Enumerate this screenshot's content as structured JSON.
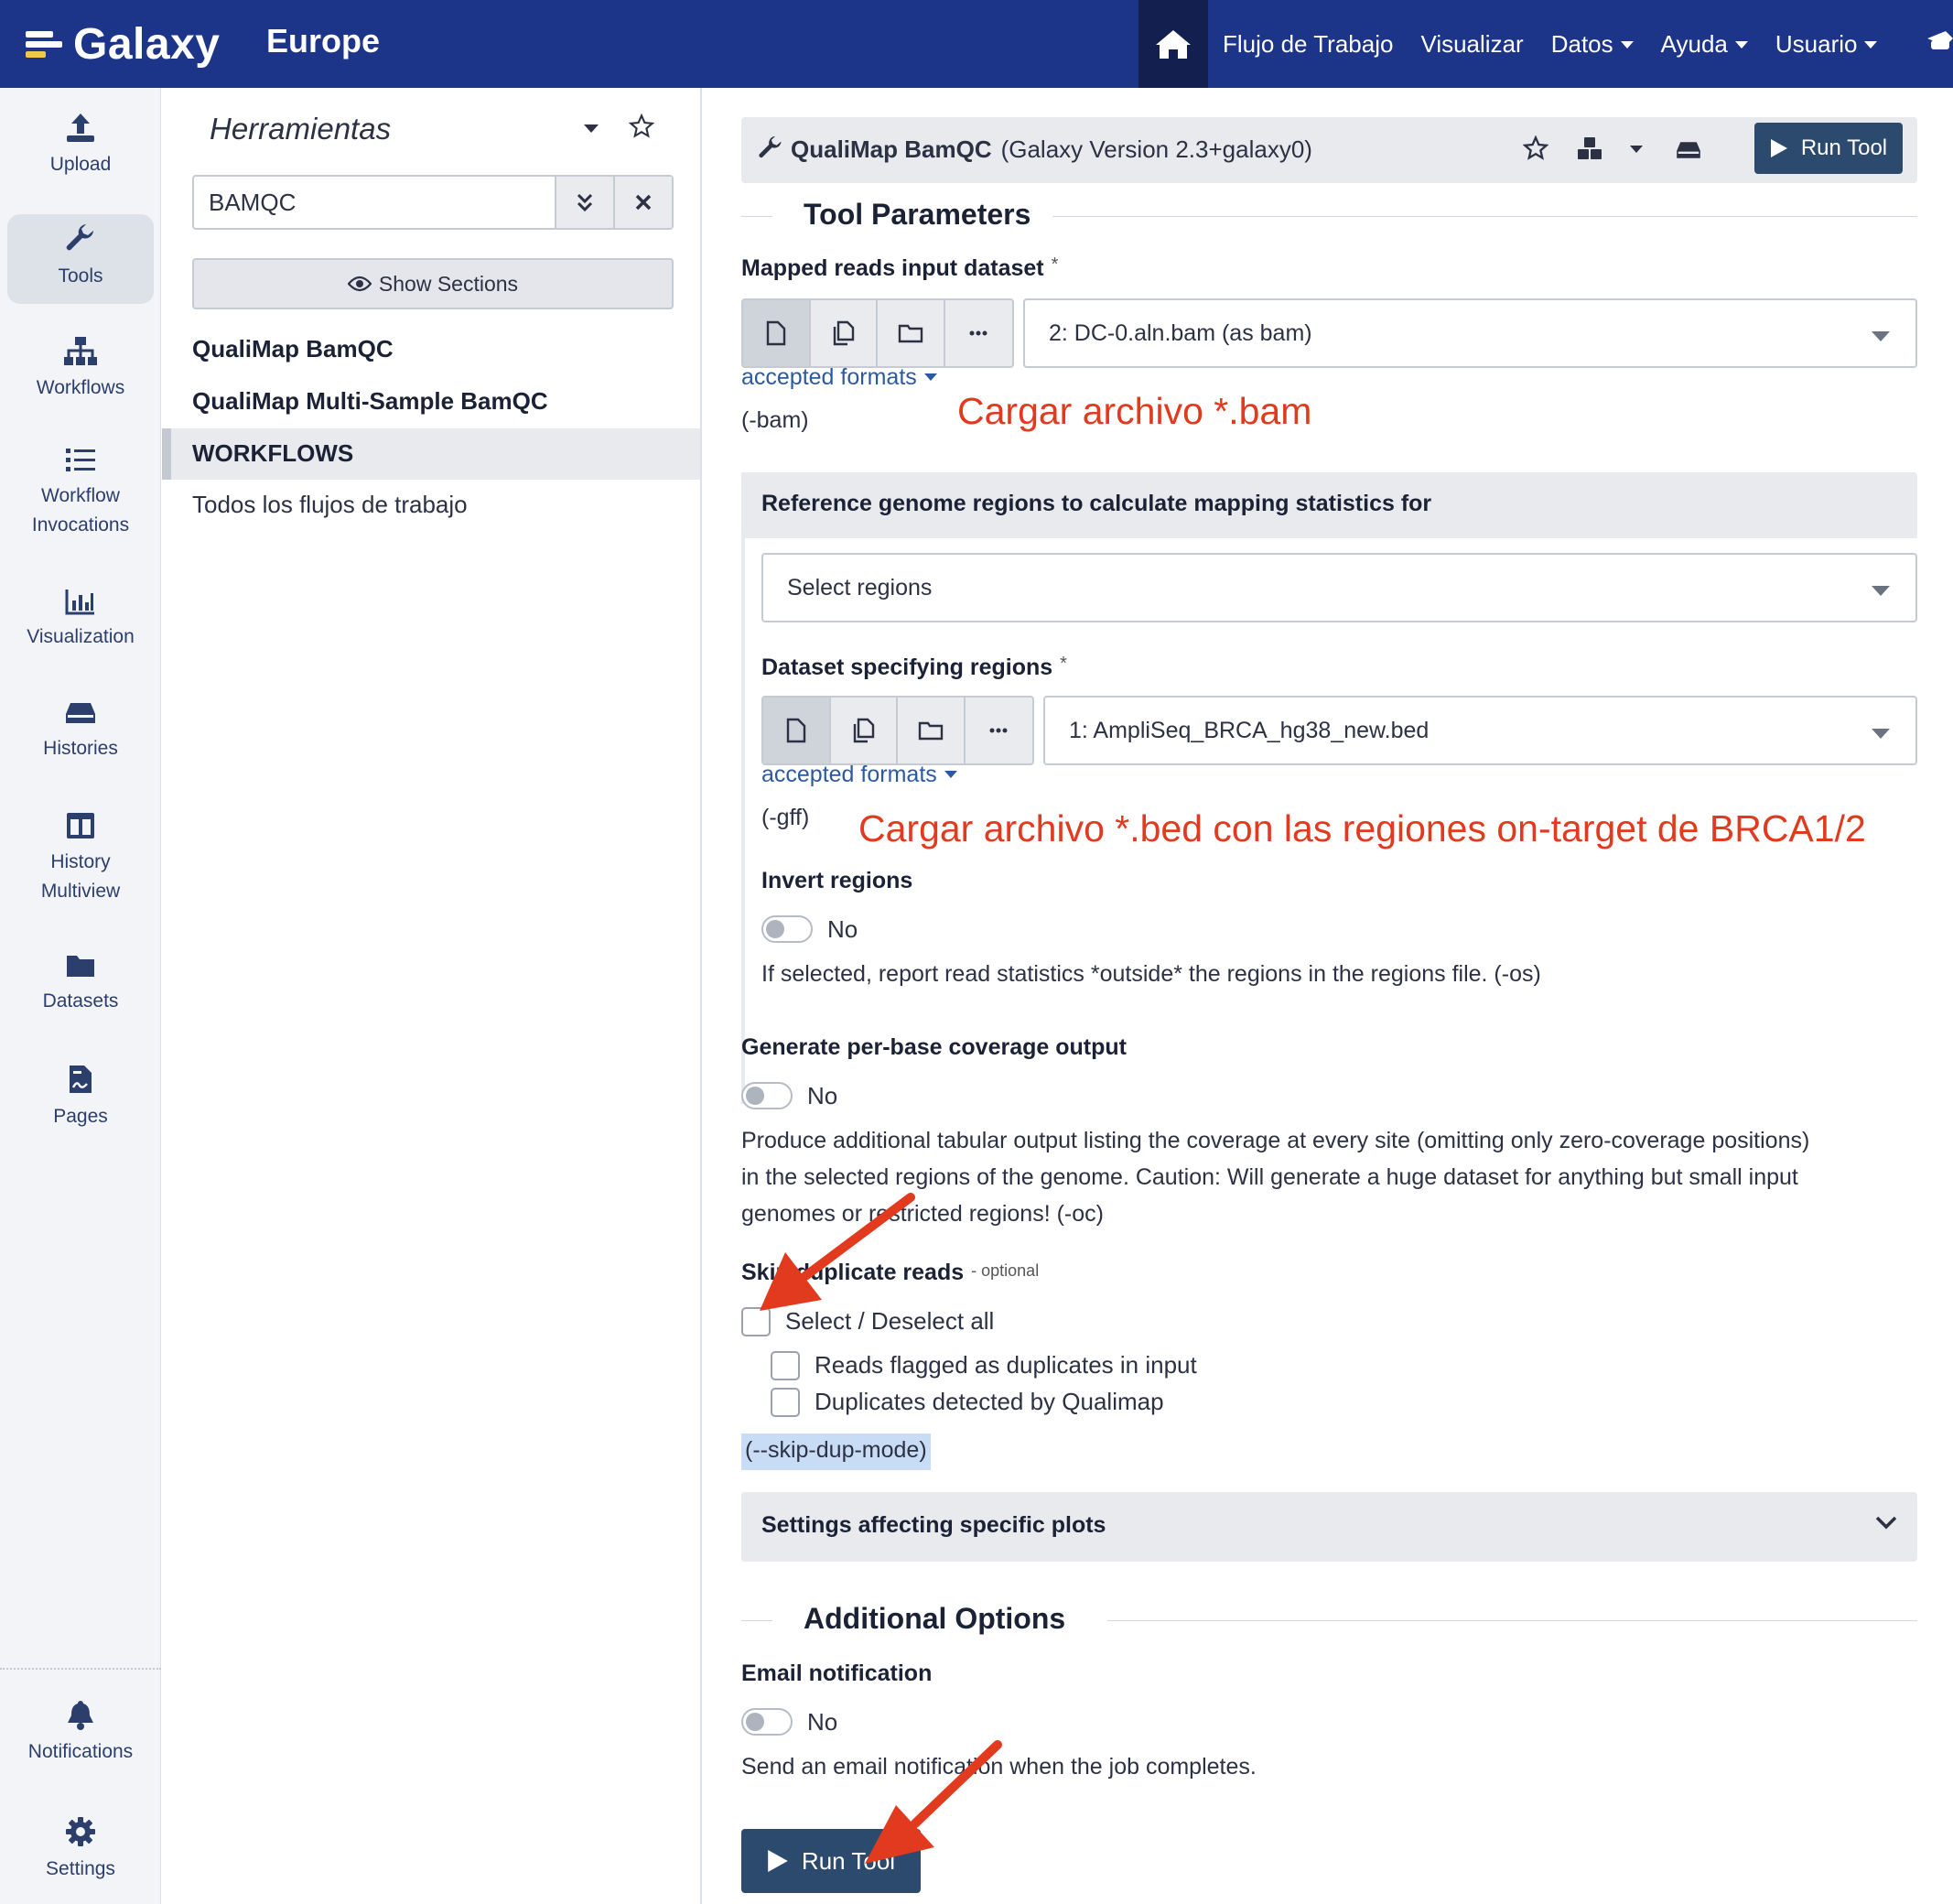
{
  "navbar": {
    "brand": "Galaxy",
    "subtitle": "Europe",
    "items": [
      {
        "label": "Flujo de Trabajo",
        "dropdown": false
      },
      {
        "label": "Visualizar",
        "dropdown": false
      },
      {
        "label": "Datos",
        "dropdown": true
      },
      {
        "label": "Ayuda",
        "dropdown": true
      },
      {
        "label": "Usuario",
        "dropdown": true
      }
    ],
    "colors": {
      "background": "#1d3589",
      "home_active": "#121f4f"
    }
  },
  "activity_bar": {
    "items": [
      {
        "label": "Upload",
        "icon": "upload-icon"
      },
      {
        "label": "Tools",
        "icon": "wrench-icon",
        "active": true
      },
      {
        "label": "Workflows",
        "icon": "sitemap-icon"
      },
      {
        "label": "Workflow Invocations",
        "icon": "list-icon"
      },
      {
        "label": "Visualization",
        "icon": "chart-bar-icon"
      },
      {
        "label": "Histories",
        "icon": "hdd-icon"
      },
      {
        "label": "History Multiview",
        "icon": "columns-icon"
      },
      {
        "label": "Datasets",
        "icon": "folder-icon"
      },
      {
        "label": "Pages",
        "icon": "file-contract-icon"
      }
    ],
    "bottom_items": [
      {
        "label": "Notifications",
        "icon": "bell-icon"
      },
      {
        "label": "Settings",
        "icon": "cog-icon"
      }
    ]
  },
  "tool_panel": {
    "title": "Herramientas",
    "search_value": "BAMQC",
    "show_sections_label": "Show Sections",
    "results": [
      "QualiMap BamQC",
      "QualiMap Multi-Sample BamQC"
    ],
    "section_label": "WORKFLOWS",
    "section_items": [
      "Todos los flujos de trabajo"
    ]
  },
  "tool": {
    "name": "QualiMap BamQC",
    "version": "(Galaxy Version 2.3+galaxy0)",
    "run_label": "Run Tool",
    "run_color": "#2c4a6e",
    "parameters_legend": "Tool Parameters",
    "mapped_reads": {
      "label": "Mapped reads input dataset",
      "required_mark": "*",
      "value": "2: DC-0.aln.bam (as bam)",
      "accepted_formats": "accepted formats",
      "help": "(-bam)"
    },
    "regions_section": {
      "title": "Reference genome regions to calculate mapping statistics for",
      "select_value": "Select regions",
      "dataset_label": "Dataset specifying regions",
      "required_mark": "*",
      "dataset_value": "1: AmpliSeq_BRCA_hg38_new.bed",
      "accepted_formats": "accepted formats",
      "help": "(-gff)",
      "invert_label": "Invert regions",
      "invert_value": "No",
      "invert_help": "If selected, report read statistics *outside* the regions in the regions file. (-os)"
    },
    "coverage": {
      "label": "Generate per-base coverage output",
      "value": "No",
      "help_line1": "Produce additional tabular output listing the coverage at every site (omitting only zero-coverage positions)",
      "help_line2": "in the selected regions of the genome. Caution: Will generate a huge dataset for anything but small input",
      "help_line3": "genomes or restricted regions! (-oc)"
    },
    "skip_duplicates": {
      "label": "Skip duplicate reads",
      "optional": "- optional",
      "select_all": "Select / Deselect all",
      "options": [
        "Reads flagged as duplicates in input",
        "Duplicates detected by Qualimap"
      ],
      "argument": "(--skip-dup-mode)"
    },
    "plots_section": "Settings affecting specific plots",
    "additional_legend": "Additional Options",
    "email": {
      "label": "Email notification",
      "value": "No",
      "help": "Send an email notification when the job completes."
    }
  },
  "annotations": {
    "bam": "Cargar archivo *.bam",
    "bed": "Cargar archivo *.bed con las regiones on-target de BRCA1/2",
    "color": "#e23a1f"
  }
}
